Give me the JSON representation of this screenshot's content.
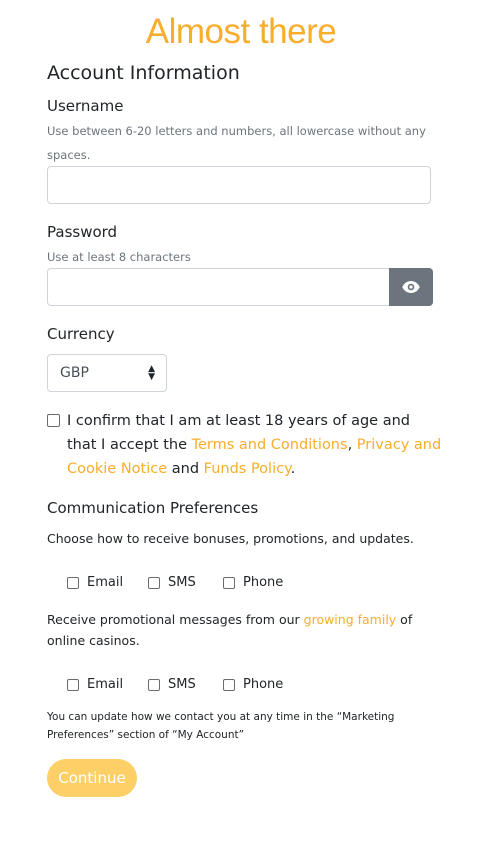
{
  "header": {
    "title": "Almost there"
  },
  "account": {
    "section_title": "Account Information",
    "username": {
      "label": "Username",
      "hint": "Use between 6-20 letters and numbers, all lowercase without any spaces.",
      "value": ""
    },
    "password": {
      "label": "Password",
      "hint": "Use at least 8 characters",
      "value": "",
      "toggle_icon": "eye-icon"
    },
    "currency": {
      "label": "Currency",
      "selected": "GBP"
    }
  },
  "confirm": {
    "text_1": "I confirm that I am at least 18 years of age and that I accept the ",
    "terms_link": "Terms and Conditions",
    "sep": ", ",
    "privacy_link": "Privacy and Cookie Notice",
    "and": " and ",
    "funds_link": "Funds Policy",
    "end": "."
  },
  "communication": {
    "title": "Communication Preferences",
    "subtitle": "Choose how to receive bonuses, promotions, and updates.",
    "options_1": [
      "Email",
      "SMS",
      "Phone"
    ],
    "family_text_1": "Receive promotional messages from our ",
    "family_link": "growing family",
    "family_text_2": " of online casinos.",
    "options_2": [
      "Email",
      "SMS",
      "Phone"
    ],
    "footer_note": "You can update how we contact you at any time in the “Marketing Preferences” section of “My Account”"
  },
  "actions": {
    "continue_label": "Continue"
  },
  "colors": {
    "accent": "#f8ad2c",
    "button": "#fcd067",
    "eye_button": "#6c757d"
  }
}
